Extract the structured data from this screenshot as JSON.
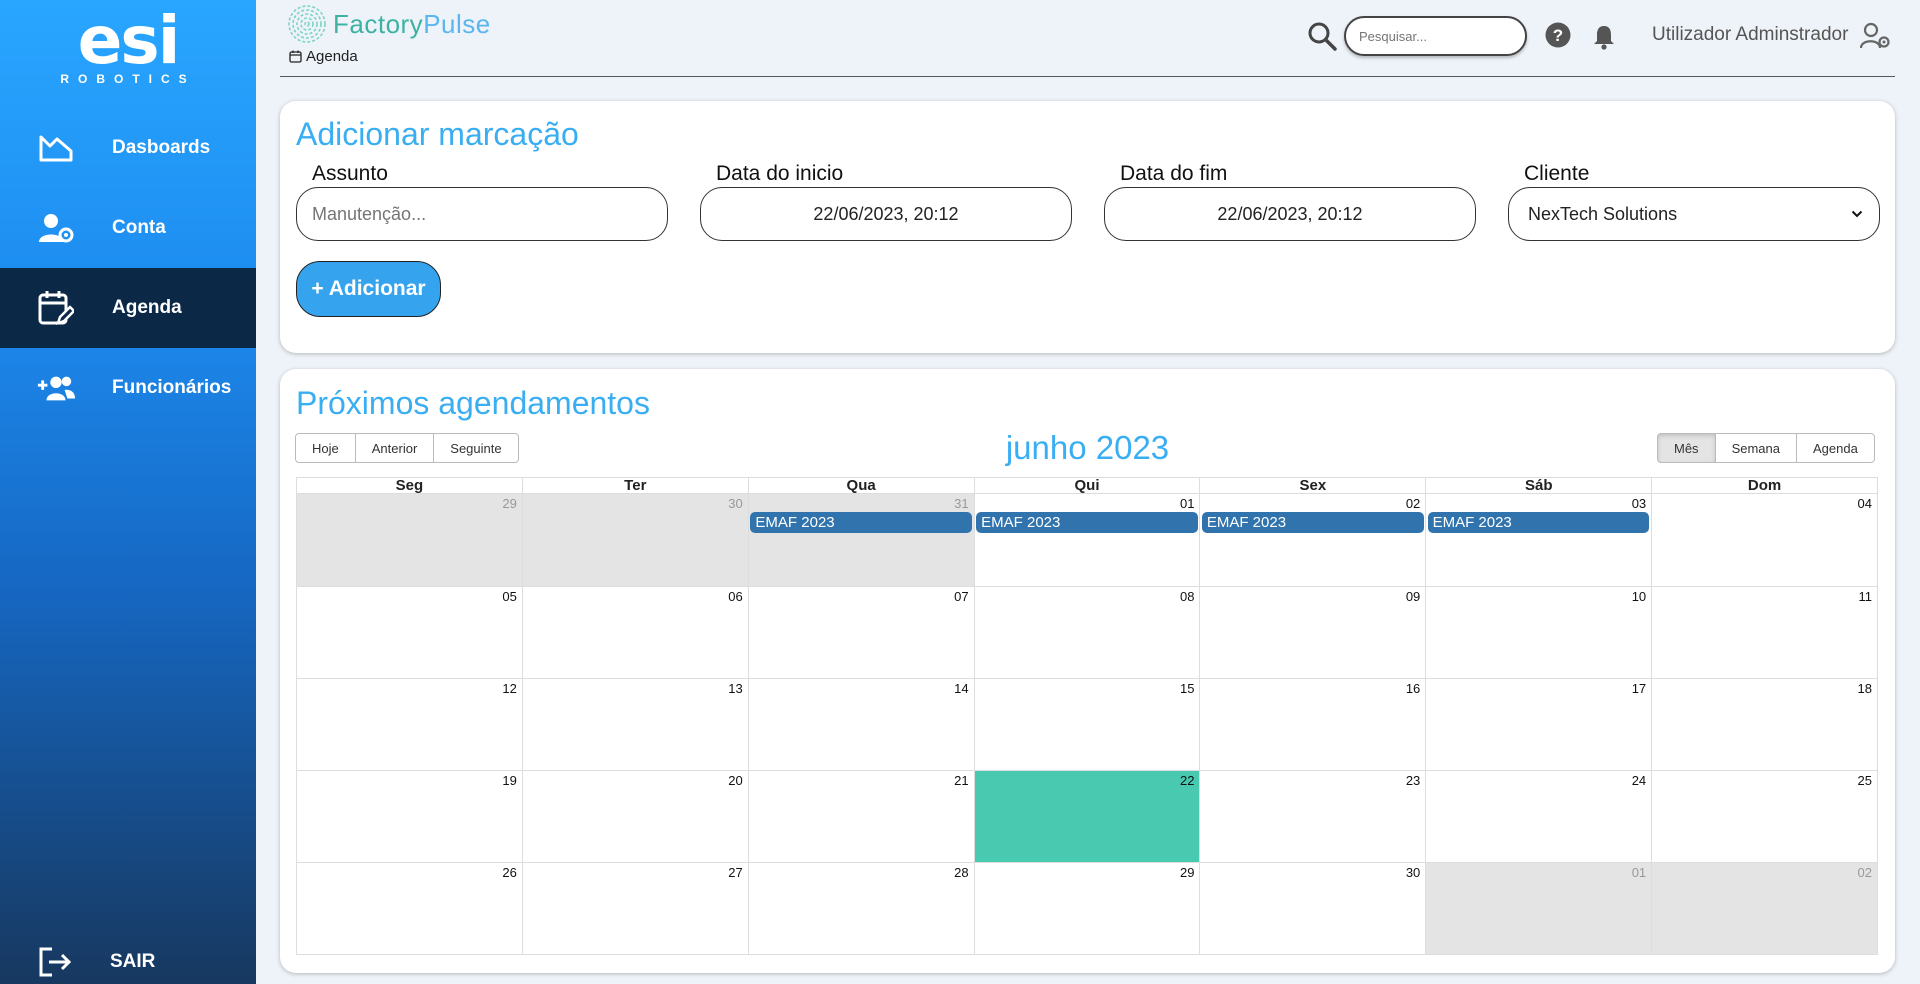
{
  "sidebar": {
    "logo_mark": "esi",
    "logo_sub": "ROBOTICS",
    "items": [
      {
        "label": "Dasboards"
      },
      {
        "label": "Conta"
      },
      {
        "label": "Agenda"
      },
      {
        "label": "Funcionários"
      }
    ],
    "logout_label": "SAIR"
  },
  "header": {
    "brand_a": "Factory",
    "brand_b": "Pulse",
    "breadcrumb": "Agenda",
    "search_placeholder": "Pesquisar...",
    "user_name": "Utilizador Adminstrador"
  },
  "form": {
    "title": "Adicionar marcação",
    "subject_label": "Assunto",
    "subject_placeholder": "Manutenção...",
    "start_label": "Data do inicio",
    "start_value": "22/06/2023, 20:12",
    "end_label": "Data do fim",
    "end_value": "22/06/2023, 20:12",
    "client_label": "Cliente",
    "client_value": "NexTech Solutions",
    "add_button": "+ Adicionar"
  },
  "calendar": {
    "title": "Próximos agendamentos",
    "month_label": "junho 2023",
    "nav": {
      "today": "Hoje",
      "prev": "Anterior",
      "next": "Seguinte"
    },
    "views": {
      "month": "Mês",
      "week": "Semana",
      "agenda": "Agenda",
      "active": "month"
    },
    "weekdays": [
      "Seg",
      "Ter",
      "Qua",
      "Qui",
      "Sex",
      "Sáb",
      "Dom"
    ],
    "weeks": [
      [
        "29",
        "30",
        "31",
        "01",
        "02",
        "03",
        "04"
      ],
      [
        "05",
        "06",
        "07",
        "08",
        "09",
        "10",
        "11"
      ],
      [
        "12",
        "13",
        "14",
        "15",
        "16",
        "17",
        "18"
      ],
      [
        "19",
        "20",
        "21",
        "22",
        "23",
        "24",
        "25"
      ],
      [
        "26",
        "27",
        "28",
        "29",
        "30",
        "01",
        "02"
      ]
    ],
    "off_range": [
      [
        0,
        0
      ],
      [
        0,
        1
      ],
      [
        0,
        2
      ],
      [
        4,
        5
      ],
      [
        4,
        6
      ]
    ],
    "today": [
      3,
      3
    ],
    "events": [
      {
        "title": "EMAF 2023",
        "week": 0,
        "day": 2
      },
      {
        "title": "EMAF 2023",
        "week": 0,
        "day": 3
      },
      {
        "title": "EMAF 2023",
        "week": 0,
        "day": 4
      },
      {
        "title": "EMAF 2023",
        "week": 0,
        "day": 5
      }
    ]
  },
  "colors": {
    "accent": "#3aaef3",
    "event": "#3174ad",
    "today": "#48c9b0",
    "sidebar_active": "#0b2947"
  }
}
